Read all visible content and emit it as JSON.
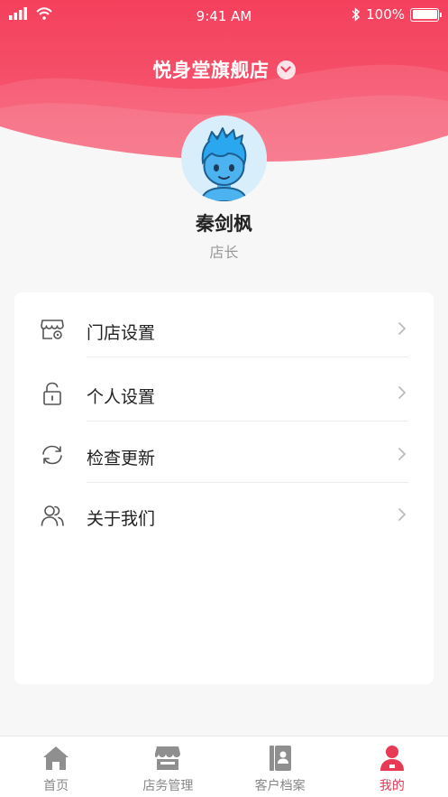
{
  "status_bar": {
    "time": "9:41 AM",
    "battery": "100%"
  },
  "header": {
    "shop_name": "悦身堂旗舰店",
    "accent_color": "#f23f5c"
  },
  "profile": {
    "name": "秦剑枫",
    "role": "店长"
  },
  "menu": [
    {
      "label": "门店设置",
      "icon": "store-settings-icon"
    },
    {
      "label": "个人设置",
      "icon": "unlock-icon"
    },
    {
      "label": "检查更新",
      "icon": "refresh-icon"
    },
    {
      "label": "关于我们",
      "icon": "users-icon"
    }
  ],
  "tabbar": [
    {
      "label": "首页",
      "icon": "home-icon",
      "active": false
    },
    {
      "label": "店务管理",
      "icon": "store-icon",
      "active": false
    },
    {
      "label": "客户档案",
      "icon": "contacts-book-icon",
      "active": false
    },
    {
      "label": "我的",
      "icon": "user-icon",
      "active": true
    }
  ]
}
